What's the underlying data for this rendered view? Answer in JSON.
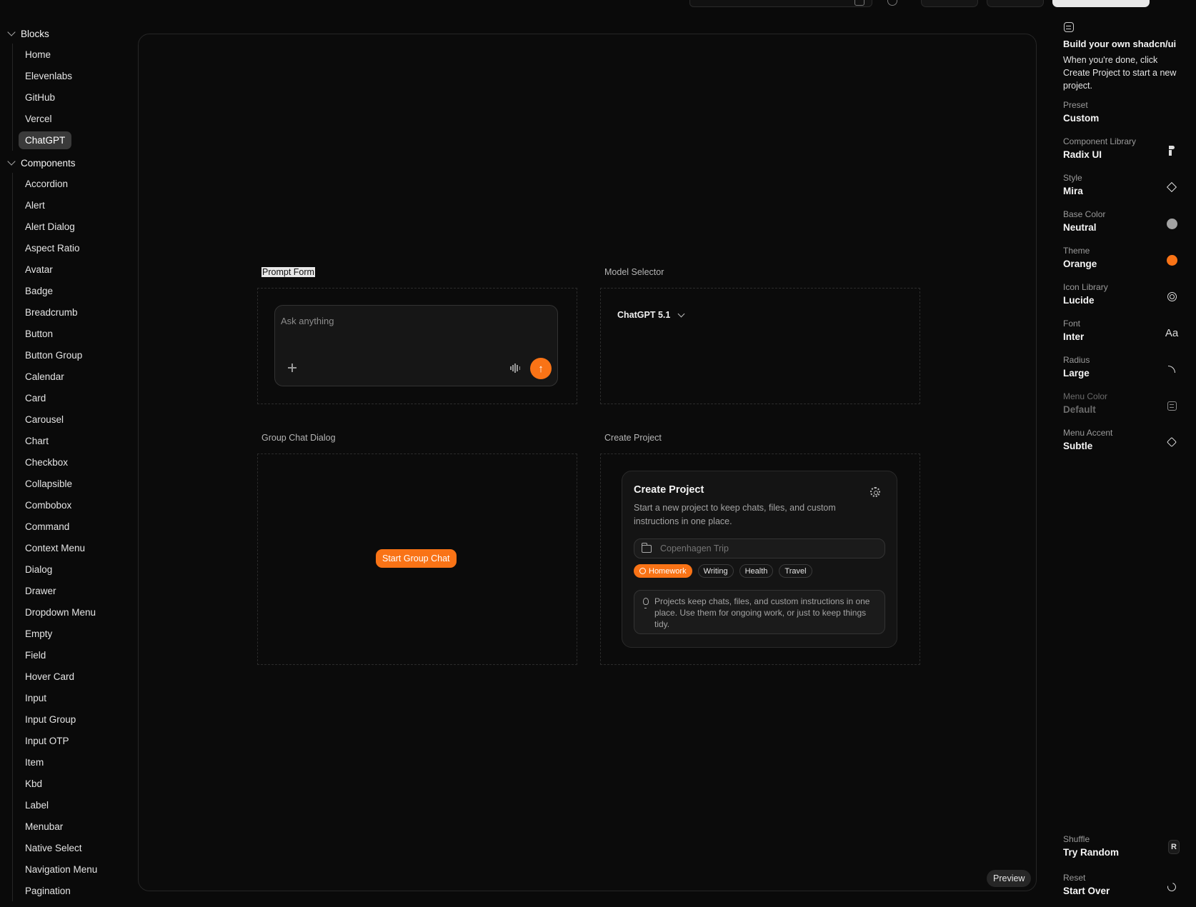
{
  "sidebar": {
    "groups": [
      {
        "title": "Blocks",
        "items": [
          "Home",
          "Elevenlabs",
          "GitHub",
          "Vercel",
          "ChatGPT"
        ],
        "active": "ChatGPT"
      },
      {
        "title": "Components",
        "items": [
          "Accordion",
          "Alert",
          "Alert Dialog",
          "Aspect Ratio",
          "Avatar",
          "Badge",
          "Breadcrumb",
          "Button",
          "Button Group",
          "Calendar",
          "Card",
          "Carousel",
          "Chart",
          "Checkbox",
          "Collapsible",
          "Combobox",
          "Command",
          "Context Menu",
          "Dialog",
          "Drawer",
          "Dropdown Menu",
          "Empty",
          "Field",
          "Hover Card",
          "Input",
          "Input Group",
          "Input OTP",
          "Item",
          "Kbd",
          "Label",
          "Menubar",
          "Native Select",
          "Navigation Menu",
          "Pagination"
        ]
      }
    ]
  },
  "main": {
    "sections": {
      "prompt_form": "Prompt Form",
      "model_selector": "Model Selector",
      "group_chat": "Group Chat Dialog",
      "create_project": "Create Project"
    },
    "prompt": {
      "placeholder": "Ask anything",
      "send_icon": "arrow-up-icon"
    },
    "model": {
      "selected": "ChatGPT 5.1"
    },
    "group_chat_button": "Start Group Chat",
    "card": {
      "title": "Create Project",
      "description": "Start a new project to keep chats, files, and custom instructions in one place.",
      "name_placeholder": "Copenhagen Trip",
      "tags": [
        {
          "label": "Homework",
          "active": true
        },
        {
          "label": "Writing",
          "active": false
        },
        {
          "label": "Health",
          "active": false
        },
        {
          "label": "Travel",
          "active": false
        }
      ],
      "info": "Projects keep chats, files, and custom instructions in one place. Use them for ongoing work, or just to keep things tidy."
    },
    "preview_label": "Preview"
  },
  "panel": {
    "title": "Build your own shadcn/ui",
    "description": "When you're done, click Create Project to start a new project.",
    "options": [
      {
        "label": "Preset",
        "value": "Custom",
        "icon": ""
      },
      {
        "label": "Component Library",
        "value": "Radix UI",
        "icon": "radix-icon"
      },
      {
        "label": "Style",
        "value": "Mira",
        "icon": "diamond-icon"
      },
      {
        "label": "Base Color",
        "value": "Neutral",
        "icon": "color-dot-icon",
        "color": "#a3a3a3"
      },
      {
        "label": "Theme",
        "value": "Orange",
        "icon": "color-dot-icon",
        "color": "#f97316"
      },
      {
        "label": "Icon Library",
        "value": "Lucide",
        "icon": "swirl-icon"
      },
      {
        "label": "Font",
        "value": "Inter",
        "icon": "font-icon",
        "glyph": "Aa"
      },
      {
        "label": "Radius",
        "value": "Large",
        "icon": "radius-icon"
      },
      {
        "label": "Menu Color",
        "value": "Default",
        "icon": "menu-icon",
        "disabled": true
      },
      {
        "label": "Menu Accent",
        "value": "Subtle",
        "icon": "paint-bucket-icon"
      }
    ],
    "shuffle": {
      "label": "Shuffle",
      "value": "Try Random",
      "key": "R"
    },
    "reset": {
      "label": "Reset",
      "value": "Start Over"
    }
  },
  "colors": {
    "accent": "#f97316",
    "background": "#0a0a0a"
  }
}
